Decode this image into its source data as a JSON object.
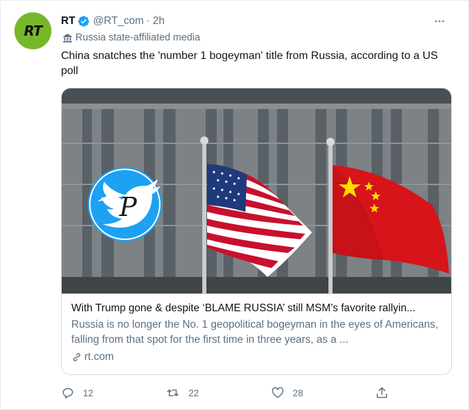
{
  "tweet": {
    "author_name": "RT",
    "avatar_text": "RT",
    "handle": "@RT_com",
    "separator": "·",
    "time": "2h",
    "label": "Russia state-affiliated media",
    "text": "China snatches the 'number 1 bogeyman' title from Russia, according to a US poll"
  },
  "card": {
    "title": "With Trump gone & despite ‘BLAME RUSSIA’ still MSM’s favorite rallyin...",
    "description": "Russia is no longer the No. 1 geopolitical bogeyman in the eyes of Americans, falling from that spot for the first time in three years, as a ...",
    "domain": "rt.com",
    "watermark_letter": "P"
  },
  "actions": {
    "reply_count": "12",
    "retweet_count": "22",
    "like_count": "28"
  },
  "icons": {
    "verified": "verified-badge-icon",
    "more": "more-icon",
    "label": "government-building-icon",
    "link": "link-icon",
    "reply": "reply-icon",
    "retweet": "retweet-icon",
    "like": "like-icon",
    "share": "share-icon"
  },
  "colors": {
    "brand_green": "#77b82a",
    "verified_blue": "#1da1f2",
    "muted_text": "#5b7083",
    "border": "#cfd9de"
  }
}
